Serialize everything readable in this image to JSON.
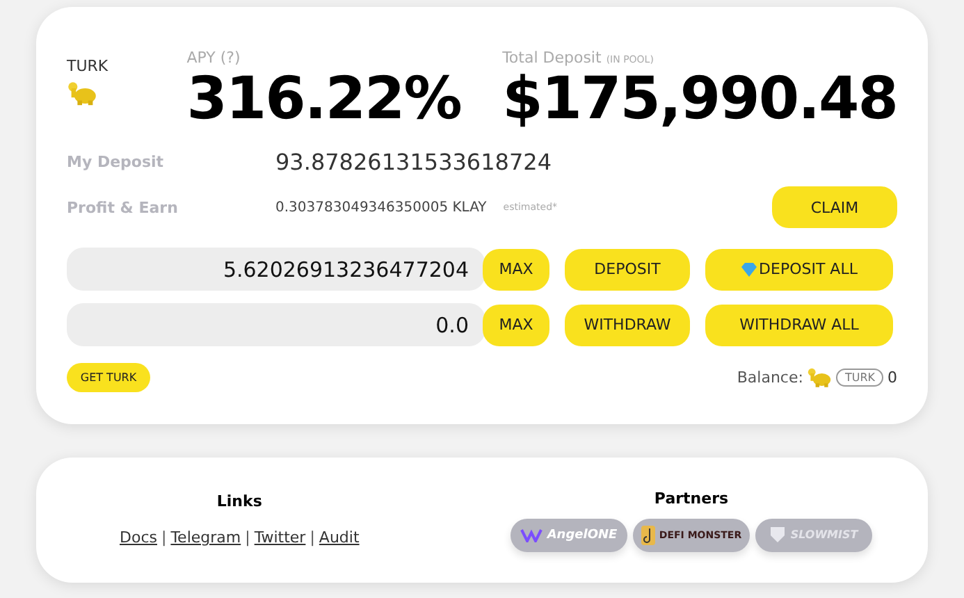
{
  "token": {
    "label": "TURK"
  },
  "apy": {
    "label": "APY (?)",
    "value": "316.22%"
  },
  "total_deposit": {
    "label": "Total Deposit",
    "sub": "(IN POOL)",
    "value": "$175,990.48"
  },
  "my_deposit": {
    "label": "My Deposit",
    "value": "93.87826131533618724"
  },
  "profit": {
    "label": "Profit & Earn",
    "value": "0.303783049346350005 KLAY",
    "note": "estimated*",
    "button": "CLAIM"
  },
  "rows": [
    {
      "value": "5.62026913236477204",
      "max": "MAX",
      "action": "DEPOSIT",
      "all": "DEPOSIT ALL",
      "gem": true
    },
    {
      "value": "0.0",
      "max": "MAX",
      "action": "WITHDRAW",
      "all": "WITHDRAW ALL",
      "gem": false
    }
  ],
  "get_button": "GET TURK",
  "balance": {
    "label": "Balance:",
    "unit": "TURK",
    "value": "0"
  },
  "links": {
    "title": "Links",
    "items": [
      "Docs",
      "Telegram",
      "Twitter",
      "Audit"
    ],
    "separator": "|"
  },
  "partners": {
    "title": "Partners",
    "items": [
      {
        "name": "AngelONE",
        "kind": "angel"
      },
      {
        "name": "DEFI MONSTER",
        "kind": "monster"
      },
      {
        "name": "SLOWMIST",
        "kind": "slowmist"
      }
    ]
  }
}
